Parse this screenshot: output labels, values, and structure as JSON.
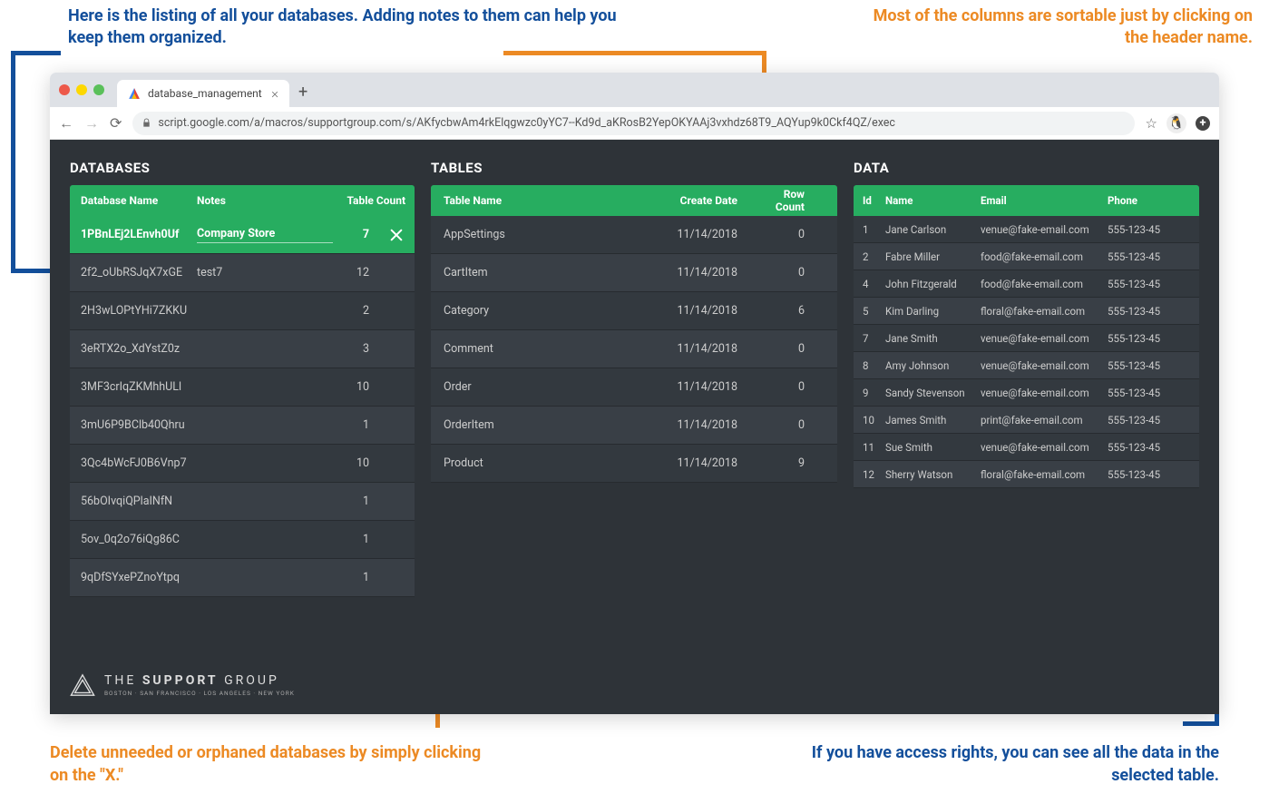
{
  "annotations": {
    "top_left": "Here is the listing of all your databases. Adding notes to them can help you keep them organized.",
    "top_right": "Most of the columns are sortable just by clicking on the header name.",
    "bottom_left": "Delete unneeded or orphaned databases by simply clicking on the \"X.\"",
    "bottom_right": "If you have access rights, you can see all the data in the selected table."
  },
  "browser": {
    "tab_title": "database_management",
    "url": "script.google.com/a/macros/supportgroup.com/s/AKfycbwAm4rkElqgwzc0yYC7--Kd9d_aKRosB2YepOKYAAj3vxhdz68T9_AQYup9k0Ckf4QZ/exec"
  },
  "panels": {
    "databases": {
      "title": "DATABASES",
      "headers": {
        "name": "Database Name",
        "notes": "Notes",
        "count": "Table Count"
      },
      "rows": [
        {
          "name": "1PBnLEj2LEnvh0Uf",
          "notes": "Company Store",
          "count": "7",
          "selected": true
        },
        {
          "name": "2f2_oUbRSJqX7xGE",
          "notes": "test7",
          "count": "12"
        },
        {
          "name": "2H3wLOPtYHi7ZKKU",
          "notes": "",
          "count": "2"
        },
        {
          "name": "3eRTX2o_XdYstZ0z",
          "notes": "",
          "count": "3"
        },
        {
          "name": "3MF3crIqZKMhhULl",
          "notes": "",
          "count": "10"
        },
        {
          "name": "3mU6P9BClb40Qhru",
          "notes": "",
          "count": "1"
        },
        {
          "name": "3Qc4bWcFJ0B6Vnp7",
          "notes": "",
          "count": "10"
        },
        {
          "name": "56bOIvqiQPlaINfN",
          "notes": "",
          "count": "1"
        },
        {
          "name": "5ov_0q2o76iQg86C",
          "notes": "",
          "count": "1"
        },
        {
          "name": "9qDfSYxePZnoYtpq",
          "notes": "",
          "count": "1"
        }
      ]
    },
    "tables": {
      "title": "TABLES",
      "headers": {
        "name": "Table Name",
        "date": "Create Date",
        "count": "Row Count"
      },
      "rows": [
        {
          "name": "AppSettings",
          "date": "11/14/2018",
          "count": "0"
        },
        {
          "name": "CartItem",
          "date": "11/14/2018",
          "count": "0"
        },
        {
          "name": "Category",
          "date": "11/14/2018",
          "count": "6"
        },
        {
          "name": "Comment",
          "date": "11/14/2018",
          "count": "0"
        },
        {
          "name": "Order",
          "date": "11/14/2018",
          "count": "0"
        },
        {
          "name": "OrderItem",
          "date": "11/14/2018",
          "count": "0"
        },
        {
          "name": "Product",
          "date": "11/14/2018",
          "count": "9"
        }
      ]
    },
    "data": {
      "title": "DATA",
      "headers": {
        "id": "Id",
        "name": "Name",
        "email": "Email",
        "phone": "Phone"
      },
      "rows": [
        {
          "id": "1",
          "name": "Jane Carlson",
          "email": "venue@fake-email.com",
          "phone": "555-123-45"
        },
        {
          "id": "2",
          "name": "Fabre Miller",
          "email": "food@fake-email.com",
          "phone": "555-123-45"
        },
        {
          "id": "4",
          "name": "John Fitzgerald",
          "email": "food@fake-email.com",
          "phone": "555-123-45"
        },
        {
          "id": "5",
          "name": "Kim Darling",
          "email": "floral@fake-email.com",
          "phone": "555-123-45"
        },
        {
          "id": "7",
          "name": "Jane Smith",
          "email": "venue@fake-email.com",
          "phone": "555-123-45"
        },
        {
          "id": "8",
          "name": "Amy Johnson",
          "email": "venue@fake-email.com",
          "phone": "555-123-45"
        },
        {
          "id": "9",
          "name": "Sandy Stevenson",
          "email": "venue@fake-email.com",
          "phone": "555-123-45"
        },
        {
          "id": "10",
          "name": "James Smith",
          "email": "print@fake-email.com",
          "phone": "555-123-45"
        },
        {
          "id": "11",
          "name": "Sue Smith",
          "email": "venue@fake-email.com",
          "phone": "555-123-45"
        },
        {
          "id": "12",
          "name": "Sherry Watson",
          "email": "floral@fake-email.com",
          "phone": "555-123-45"
        }
      ]
    }
  },
  "footer": {
    "brand_light": "THE",
    "brand_bold": "SUPPORT",
    "brand_light2": "GROUP",
    "sub": "BOSTON · SAN FRANCISCO · LOS ANGELES · NEW YORK"
  }
}
